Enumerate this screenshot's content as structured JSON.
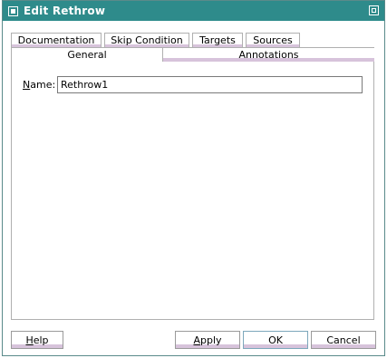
{
  "window": {
    "title": "Edit Rethrow"
  },
  "tabs_row1": [
    {
      "label": "Documentation"
    },
    {
      "label": "Skip Condition"
    },
    {
      "label": "Targets"
    },
    {
      "label": "Sources"
    }
  ],
  "tabs_row2": [
    {
      "label": "General",
      "selected": true
    },
    {
      "label": "Annotations",
      "selected": false
    }
  ],
  "form": {
    "name_label": "Name:",
    "name_value": "Rethrow1"
  },
  "buttons": {
    "help": "Help",
    "apply": "Apply",
    "ok": "OK",
    "cancel": "Cancel"
  },
  "colors": {
    "titlebar": "#2e8b8b",
    "tab_accent": "#d7c3db",
    "border": "#b0b0b0"
  },
  "icons": [
    "window-icon",
    "maximize-icon"
  ]
}
